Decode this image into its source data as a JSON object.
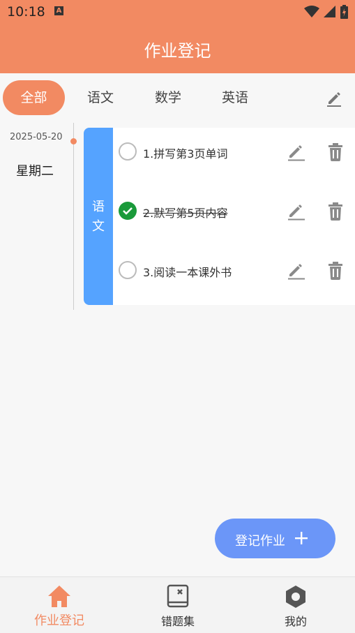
{
  "status_bar": {
    "time": "10:18",
    "badge": "A"
  },
  "header": {
    "title": "作业登记"
  },
  "tabs": [
    {
      "label": "全部",
      "active": true
    },
    {
      "label": "语文",
      "active": false
    },
    {
      "label": "数学",
      "active": false
    },
    {
      "label": "英语",
      "active": false
    }
  ],
  "day": {
    "date": "2025-05-20",
    "weekday": "星期二",
    "subject": "语文",
    "tasks": [
      {
        "text": "1.拼写第3页单词",
        "done": false
      },
      {
        "text": "2.默写第5页内容",
        "done": true
      },
      {
        "text": "3.阅读一本课外书",
        "done": false
      }
    ]
  },
  "fab": {
    "label": "登记作业"
  },
  "nav": [
    {
      "label": "作业登记",
      "icon": "home-icon",
      "active": true
    },
    {
      "label": "错题集",
      "icon": "book-icon",
      "active": false
    },
    {
      "label": "我的",
      "icon": "hexagon-icon",
      "active": false
    }
  ],
  "colors": {
    "primary": "#f28a62",
    "subject": "#55a3ff",
    "fab": "#6b96f8",
    "done": "#1a9a3a"
  }
}
